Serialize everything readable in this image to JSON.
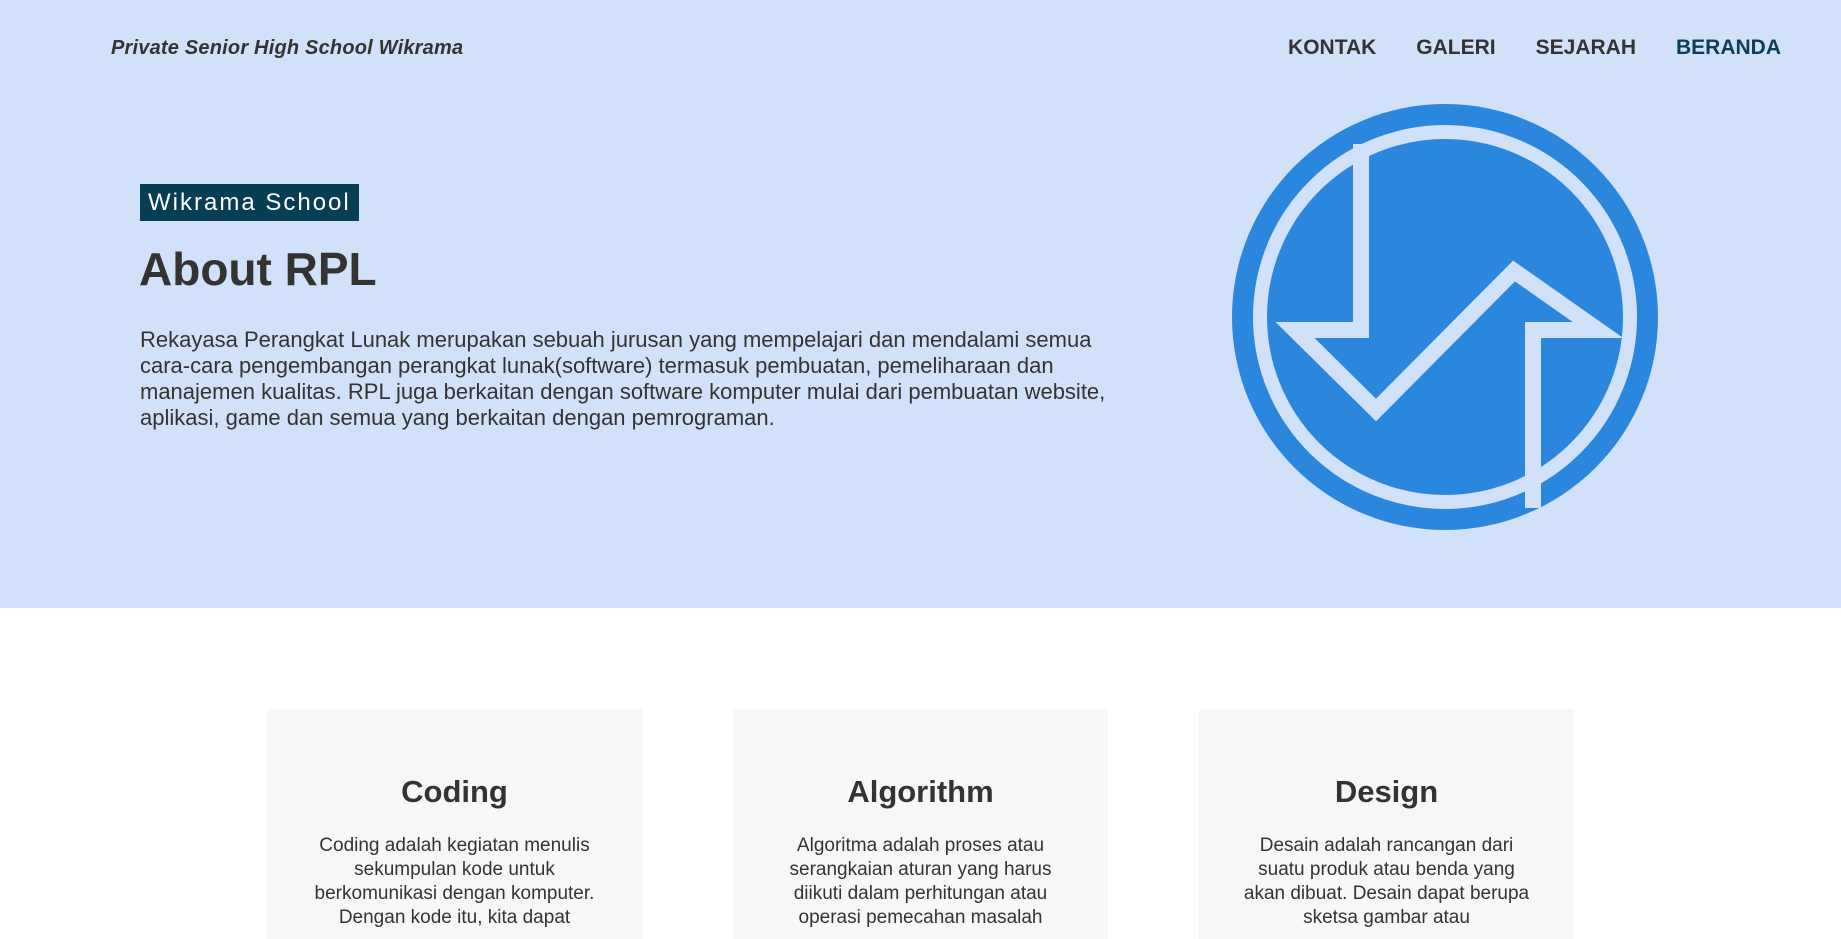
{
  "header": {
    "brand": "Private Senior High School Wikrama",
    "nav": [
      "KONTAK",
      "GALERI",
      "SEJARAH",
      "BERANDA"
    ],
    "active_nav": "BERANDA"
  },
  "hero": {
    "tag": "Wikrama School",
    "title": "About RPL",
    "description": "Rekayasa Perangkat Lunak merupakan sebuah jurusan yang mempelajari dan mendalami semua cara-cara pengembangan perangkat lunak(software) termasuk pembuatan, pemeliharaan dan manajemen kualitas. RPL juga berkaitan dengan software komputer mulai dari pembuatan website, aplikasi, game dan semua yang berkaitan dengan pemrograman."
  },
  "cards": [
    {
      "title": "Coding",
      "text": "Coding adalah kegiatan menulis sekumpulan kode untuk berkomunikasi dengan komputer. Dengan kode itu, kita dapat"
    },
    {
      "title": "Algorithm",
      "text": "Algoritma adalah proses atau serangkaian aturan yang harus diikuti dalam perhitungan atau operasi pemecahan masalah"
    },
    {
      "title": "Design",
      "text": "Desain adalah rancangan dari suatu produk atau benda yang akan dibuat. Desain dapat berupa sketsa gambar atau"
    }
  ],
  "colors": {
    "hero_bg": "#d1e1f9",
    "tag_bg": "#073e53",
    "logo_blue": "#2b87dd",
    "active_nav": "#0c3f57",
    "card_bg": "#f6f7f9"
  },
  "icons": [
    "rpl-logo-icon"
  ]
}
